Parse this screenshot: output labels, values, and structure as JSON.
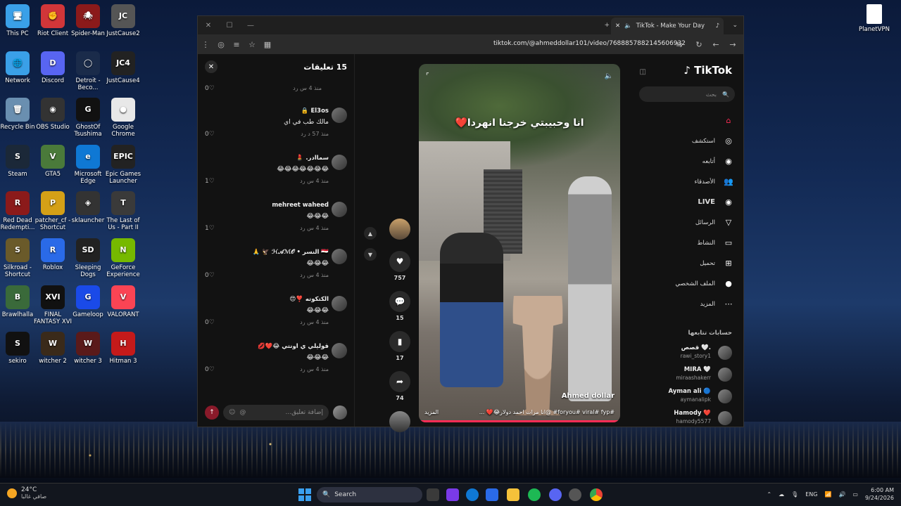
{
  "desktop_icons": [
    {
      "label": "This PC",
      "color": "#3aa0e8",
      "glyph": "🖥"
    },
    {
      "label": "Riot Client",
      "color": "#d13639",
      "glyph": "✊"
    },
    {
      "label": "Spider-Man",
      "color": "#8b1a1a",
      "glyph": "🕷"
    },
    {
      "label": "JustCause2",
      "color": "#555555",
      "glyph": "JC"
    },
    {
      "label": "Network",
      "color": "#3aa0e8",
      "glyph": "🌐"
    },
    {
      "label": "Discord",
      "color": "#5865f2",
      "glyph": "D"
    },
    {
      "label": "Detroit - Beco...",
      "color": "#1a2b4a",
      "glyph": "◯"
    },
    {
      "label": "JustCause4",
      "color": "#222222",
      "glyph": "JC4"
    },
    {
      "label": "Recycle Bin",
      "color": "#6a8fb0",
      "glyph": "🗑"
    },
    {
      "label": "OBS Studio",
      "color": "#333333",
      "glyph": "◉"
    },
    {
      "label": "GhostOf Tsushima",
      "color": "#111111",
      "glyph": "G"
    },
    {
      "label": "Google Chrome",
      "color": "#e8e8e8",
      "glyph": "●"
    },
    {
      "label": "Steam",
      "color": "#1b2838",
      "glyph": "S"
    },
    {
      "label": "GTA5",
      "color": "#4a7a3a",
      "glyph": "V"
    },
    {
      "label": "Microsoft Edge",
      "color": "#0f78d4",
      "glyph": "e"
    },
    {
      "label": "Epic Games Launcher",
      "color": "#222222",
      "glyph": "EPIC"
    },
    {
      "label": "Red Dead Redempti...",
      "color": "#8b1a1a",
      "glyph": "R"
    },
    {
      "label": "patcher_cf - Shortcut",
      "color": "#d4a017",
      "glyph": "P"
    },
    {
      "label": "sklauncher",
      "color": "#333333",
      "glyph": "◈"
    },
    {
      "label": "The Last of Us - Part II",
      "color": "#3a3a3a",
      "glyph": "T"
    },
    {
      "label": "Silkroad - Shortcut",
      "color": "#6a5a2a",
      "glyph": "S"
    },
    {
      "label": "Roblox",
      "color": "#2a6ae8",
      "glyph": "R"
    },
    {
      "label": "Sleeping Dogs",
      "color": "#222222",
      "glyph": "SD"
    },
    {
      "label": "GeForce Experience",
      "color": "#76b900",
      "glyph": "N"
    },
    {
      "label": "Brawlhalla",
      "color": "#3a6a3a",
      "glyph": "B"
    },
    {
      "label": "FINAL FANTASY XVI",
      "color": "#111111",
      "glyph": "XVI"
    },
    {
      "label": "Gameloop",
      "color": "#1a4ae8",
      "glyph": "G"
    },
    {
      "label": "VALORANT",
      "color": "#fa4454",
      "glyph": "V"
    },
    {
      "label": "sekiro",
      "color": "#111111",
      "glyph": "S"
    },
    {
      "label": "witcher 2",
      "color": "#3a2a1a",
      "glyph": "W"
    },
    {
      "label": "witcher 3",
      "color": "#5a1a1a",
      "glyph": "W"
    },
    {
      "label": "Hitman 3",
      "color": "#c41a1a",
      "glyph": "H"
    }
  ],
  "planetvpn_label": "PlanetVPN",
  "browser": {
    "tab_title": "TikTok - Make Your Day",
    "url": "tiktok.com/@ahmeddollar101/video/7688857882145606932"
  },
  "comments_panel": {
    "title": "15 تعليقات",
    "first_time": "منذ 4 س   رد",
    "first_likes": "0♡",
    "comments": [
      {
        "name": "El3os 🔒",
        "text": "مالك طب في اي",
        "time": "منذ 57 د   رد",
        "likes": "0♡"
      },
      {
        "name": "سماادر. 💄",
        "text": "😂😂😂😂😂😂😂",
        "time": "منذ 4 س   رد",
        "likes": "1♡"
      },
      {
        "name": "mehreet waheed",
        "text": "😂😂😂",
        "time": "منذ 4 س   رد",
        "likes": "1♡"
      },
      {
        "name": "🇪🇬 النسر • ℋ𝒜ℳ𝒪 🦅 🙏",
        "text": "😂😂😂",
        "time": "منذ 4 س   رد",
        "likes": "0♡"
      },
      {
        "name": "الكتكوته ❣️😍",
        "text": "😂😂😂",
        "time": "منذ 4 س   رد",
        "likes": "0♡"
      },
      {
        "name": "قوليلي ي اونتي 😂❤️💋",
        "text": "😂😂😂",
        "time": "منذ 4 س   رد",
        "likes": "0♡"
      }
    ],
    "input_placeholder": "إضافة تعليق..."
  },
  "actions": {
    "likes": "757",
    "comments": "15",
    "saves": "17",
    "shares": "74"
  },
  "video": {
    "caption": "انا وحبيبتي خرجنا انهردا❤️",
    "author": "Ahmed dollar",
    "description": "#foryou# viral# fyp# @انا مرات احمد دولار😂❤️ ...",
    "more": "المزيد",
    "progress": 0.99
  },
  "sidebar": {
    "logo": "TikTok",
    "search_placeholder": "بحث",
    "menu": [
      {
        "label": "",
        "icon": "⌂",
        "color": "#fe2c55"
      },
      {
        "label": "استكشف",
        "icon": "◎",
        "color": "#ffffff"
      },
      {
        "label": "أتابعه",
        "icon": "◉",
        "color": "#ffffff"
      },
      {
        "label": "الأصدقاء",
        "icon": "👥",
        "color": "#ffffff"
      },
      {
        "label": "LIVE",
        "icon": "◉",
        "color": "#ffffff"
      },
      {
        "label": "الرسائل",
        "icon": "▽",
        "color": "#ffffff"
      },
      {
        "label": "النشاط",
        "icon": "▭",
        "color": "#ffffff"
      },
      {
        "label": "تحميل",
        "icon": "⊞",
        "color": "#ffffff"
      },
      {
        "label": "الملف الشخصي",
        "icon": "●",
        "color": "#ffffff"
      },
      {
        "label": "المزيد",
        "icon": "⋯",
        "color": "#ffffff"
      }
    ],
    "following_header": "حسابات تتابعها",
    "following": [
      {
        "name": "قصص 🤍.",
        "user": "rawi_story1"
      },
      {
        "name": "MIRA 🤍",
        "user": "miraashakerr"
      },
      {
        "name": "Ayman ali 🔵",
        "user": "aymanalipk"
      },
      {
        "name": "Hamody ❤️",
        "user": "hamody5577"
      }
    ]
  },
  "taskbar": {
    "temp": "24°C",
    "weather": "صافي غالبا",
    "search": "Search",
    "lang": "ENG",
    "time": "6:00 AM",
    "date": "9/24/2026"
  }
}
